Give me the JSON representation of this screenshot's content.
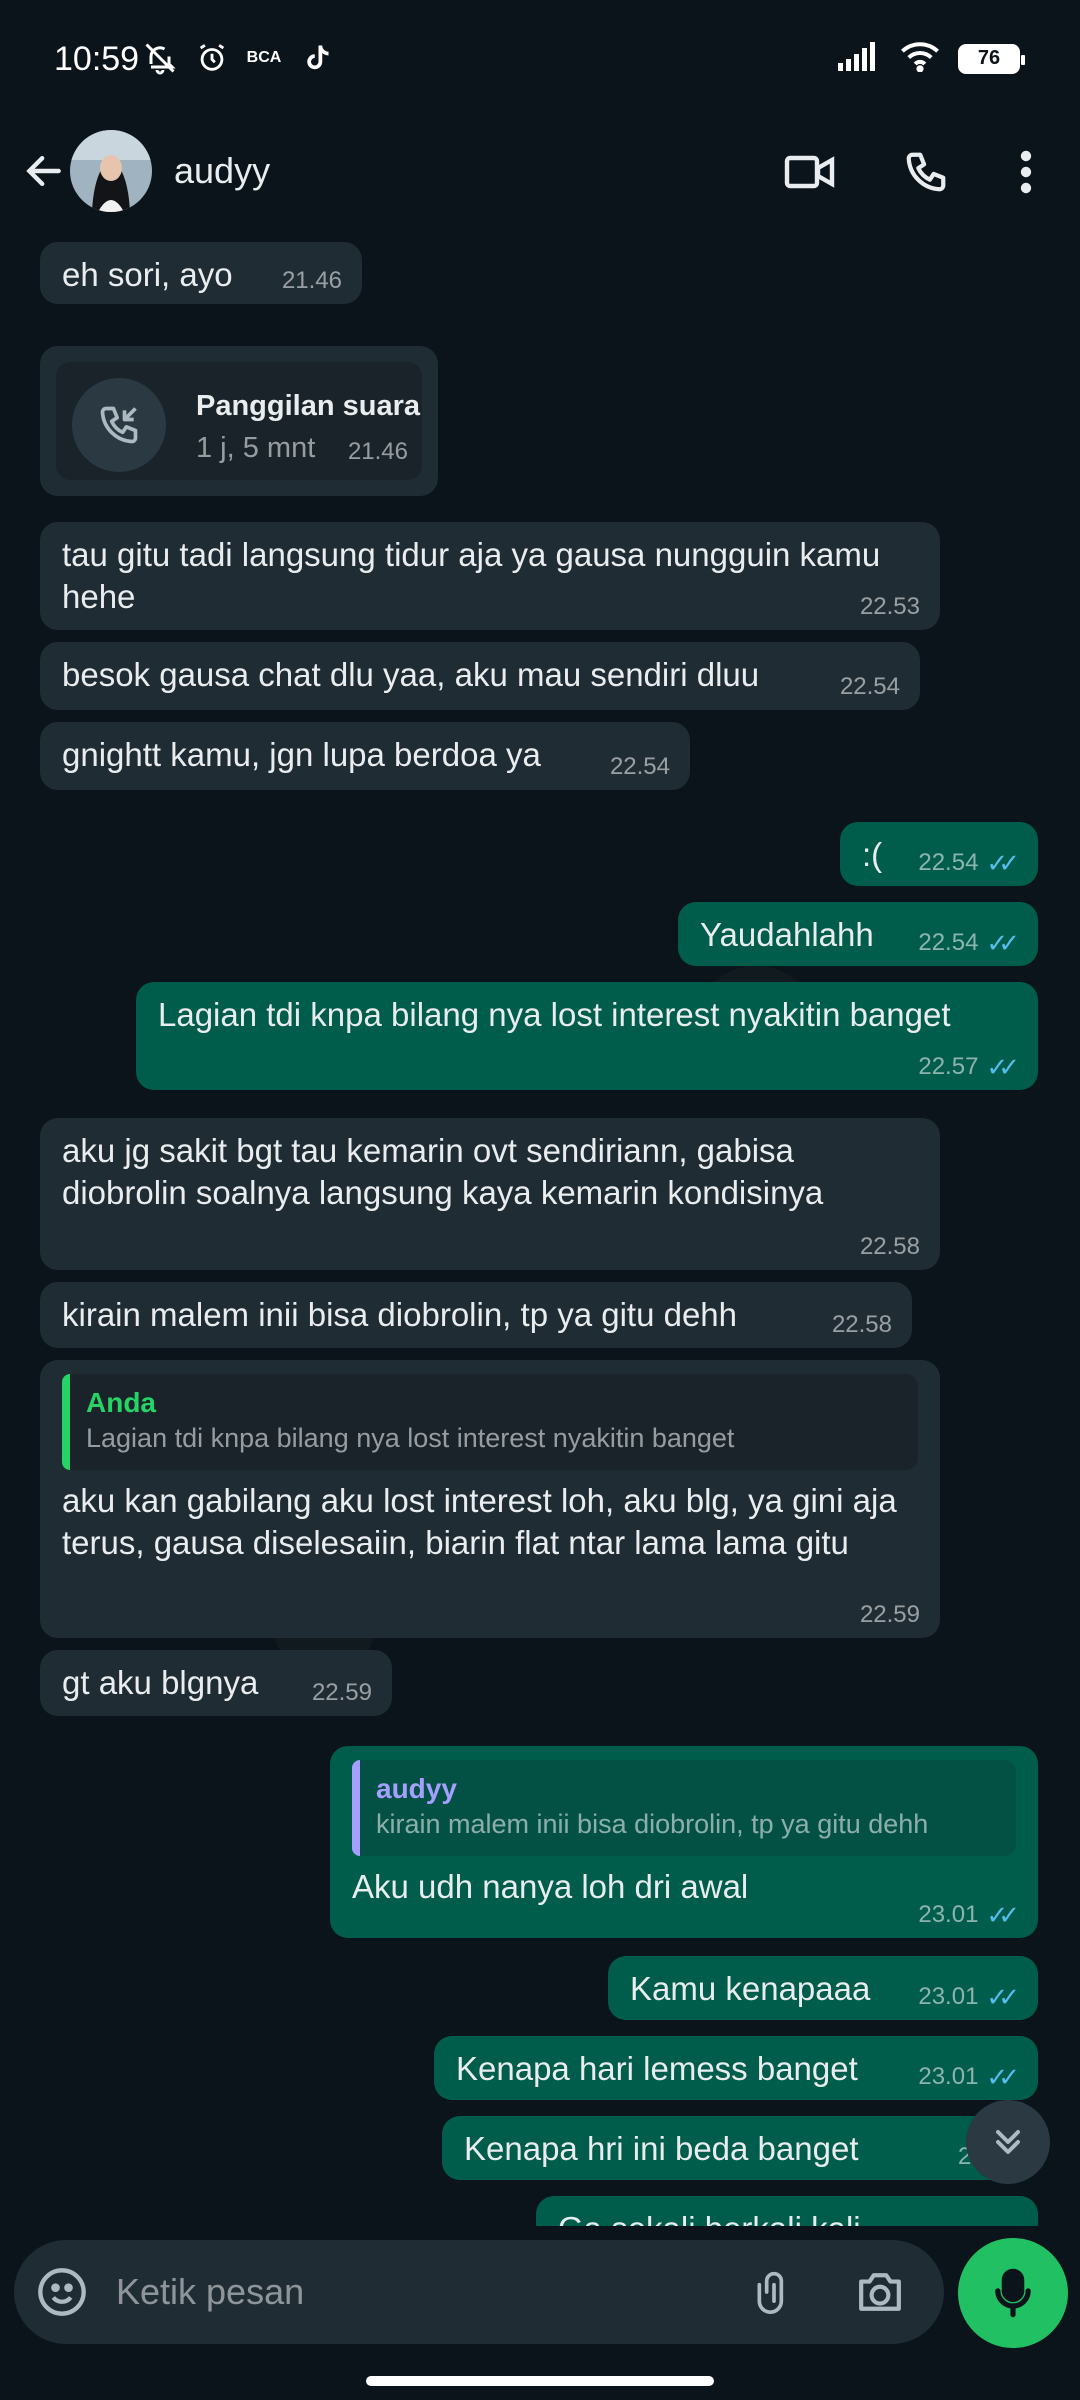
{
  "status_bar": {
    "time": "10:59",
    "battery": "76",
    "app_badge": "BCA"
  },
  "header": {
    "contact_name": "audyy"
  },
  "messages": [
    {
      "dir": "in",
      "text": "eh sori, ayo",
      "time": "21.46"
    },
    {
      "dir": "call",
      "title": "Panggilan suara",
      "duration": "1 j, 5 mnt",
      "time": "21.46"
    },
    {
      "dir": "in",
      "text": "tau gitu tadi langsung tidur aja ya gausa nungguin kamu hehe",
      "time": "22.53"
    },
    {
      "dir": "in",
      "text": "besok gausa chat dlu yaa, aku mau sendiri dluu",
      "time": "22.54"
    },
    {
      "dir": "in",
      "text": "gnightt kamu, jgn lupa berdoa ya",
      "time": "22.54"
    },
    {
      "dir": "out",
      "text": ":(",
      "time": "22.54"
    },
    {
      "dir": "out",
      "text": "Yaudahlahh",
      "time": "22.54"
    },
    {
      "dir": "out",
      "text": "Lagian tdi knpa bilang nya lost interest nyakitin banget",
      "time": "22.57"
    },
    {
      "dir": "in",
      "text": "aku jg sakit bgt tau kemarin ovt sendiriann, gabisa diobrolin soalnya langsung kaya kemarin kondisinya",
      "time": "22.58"
    },
    {
      "dir": "in",
      "text": "kirain malem inii bisa diobrolin, tp ya gitu dehh",
      "time": "22.58"
    },
    {
      "dir": "in",
      "quote_author": "Anda",
      "quote_text": "Lagian tdi knpa bilang nya lost interest nyakitin banget",
      "text": "aku kan gabilang aku lost interest loh, aku blg, ya gini aja terus, gausa diselesaiin, biarin flat ntar lama lama gitu",
      "time": "22.59"
    },
    {
      "dir": "in",
      "text": "gt aku blgnya",
      "time": "22.59"
    },
    {
      "dir": "out",
      "quote_author": "audyy",
      "quote_text": "kirain malem inii bisa diobrolin, tp ya gitu dehh",
      "text": "Aku udh nanya loh dri awal",
      "time": "23.01"
    },
    {
      "dir": "out",
      "text": "Kamu kenapaaa",
      "time": "23.01"
    },
    {
      "dir": "out",
      "text": "Kenapa hari lemess banget",
      "time": "23.01"
    },
    {
      "dir": "out",
      "text": "Kenapa hri ini beda banget",
      "time": "23.01"
    },
    {
      "dir": "out",
      "text": "Ga sekali berkali kali",
      "time": ""
    }
  ],
  "composer": {
    "placeholder": "Ketik pesan"
  },
  "icons": {
    "back": "arrow-left-icon",
    "video": "video-call-icon",
    "phone": "phone-icon",
    "menu": "more-vert-icon",
    "emoji": "emoji-icon",
    "attach": "paperclip-icon",
    "camera": "camera-icon",
    "mic": "mic-icon",
    "scroll": "double-chevron-down-icon"
  },
  "colors": {
    "incoming": "#202c33",
    "outgoing": "#005c4b",
    "accent": "#21c063",
    "read_ticks": "#53bdeb"
  }
}
